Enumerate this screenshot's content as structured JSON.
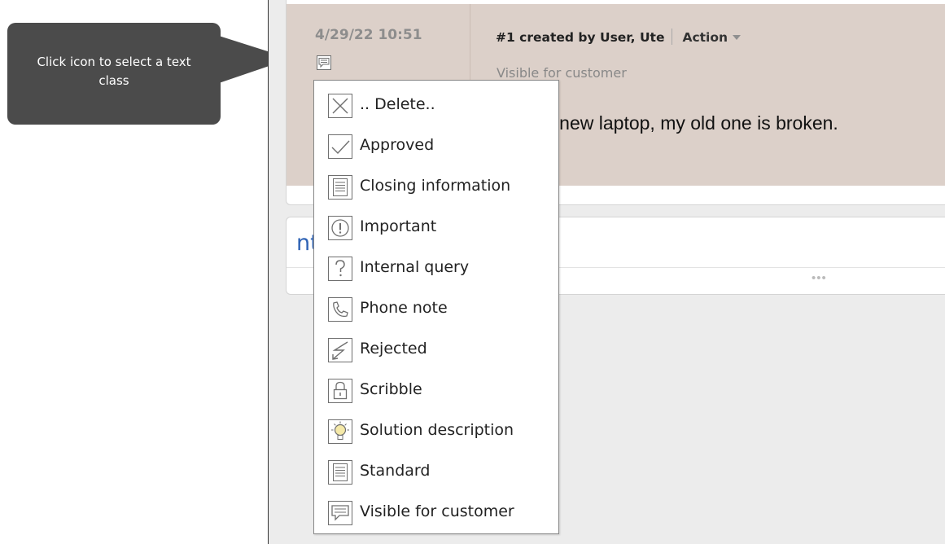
{
  "callout": {
    "text": "Click icon to select a text class"
  },
  "entry": {
    "date": "4/29/22 10:51",
    "text_class_icon": "speech-bubble-icon",
    "creator": "#1 created by User, Ute",
    "action_label": "Action",
    "visibility": "Visible for customer",
    "body": "a new laptop, my old one is broken."
  },
  "section": {
    "title_visible": "nts",
    "more_label": "•••"
  },
  "text_class_menu": {
    "items": [
      {
        "label": ".. Delete..",
        "icon": "x-box-icon"
      },
      {
        "label": "Approved",
        "icon": "checkmark-icon"
      },
      {
        "label": "Closing information",
        "icon": "document-lines-icon"
      },
      {
        "label": "Important",
        "icon": "exclamation-circle-icon"
      },
      {
        "label": "Internal query",
        "icon": "question-mark-icon"
      },
      {
        "label": "Phone note",
        "icon": "phone-icon"
      },
      {
        "label": "Rejected",
        "icon": "lightning-icon"
      },
      {
        "label": "Scribble",
        "icon": "padlock-icon"
      },
      {
        "label": "Solution description",
        "icon": "lightbulb-icon"
      },
      {
        "label": "Standard",
        "icon": "document-lines-icon"
      },
      {
        "label": "Visible for customer",
        "icon": "speech-bubble-icon"
      }
    ]
  },
  "colors": {
    "callout_bg": "#4b4b4b",
    "entry_bg": "#dcd0c9",
    "app_bg": "#ececec",
    "link_blue": "#2f63b5"
  }
}
